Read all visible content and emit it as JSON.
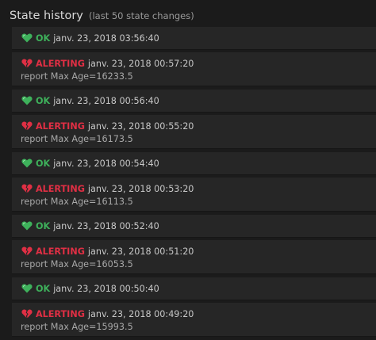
{
  "panel": {
    "title": "State history",
    "subtitle": "(last 50 state changes)"
  },
  "colors": {
    "ok": "#3eb15b",
    "alerting": "#e02f44",
    "background": "#1b1b1b",
    "row": "#262626"
  },
  "entries": [
    {
      "status": "ok",
      "icon": "heart-icon",
      "state": "OK",
      "time": "janv. 23, 2018 03:56:40",
      "detail": ""
    },
    {
      "status": "alert",
      "icon": "broken-heart-icon",
      "state": "ALERTING",
      "time": "janv. 23, 2018 00:57:20",
      "detail": "report Max Age=16233.5"
    },
    {
      "status": "ok",
      "icon": "heart-icon",
      "state": "OK",
      "time": "janv. 23, 2018 00:56:40",
      "detail": ""
    },
    {
      "status": "alert",
      "icon": "broken-heart-icon",
      "state": "ALERTING",
      "time": "janv. 23, 2018 00:55:20",
      "detail": "report Max Age=16173.5"
    },
    {
      "status": "ok",
      "icon": "heart-icon",
      "state": "OK",
      "time": "janv. 23, 2018 00:54:40",
      "detail": ""
    },
    {
      "status": "alert",
      "icon": "broken-heart-icon",
      "state": "ALERTING",
      "time": "janv. 23, 2018 00:53:20",
      "detail": "report Max Age=16113.5"
    },
    {
      "status": "ok",
      "icon": "heart-icon",
      "state": "OK",
      "time": "janv. 23, 2018 00:52:40",
      "detail": ""
    },
    {
      "status": "alert",
      "icon": "broken-heart-icon",
      "state": "ALERTING",
      "time": "janv. 23, 2018 00:51:20",
      "detail": "report Max Age=16053.5"
    },
    {
      "status": "ok",
      "icon": "heart-icon",
      "state": "OK",
      "time": "janv. 23, 2018 00:50:40",
      "detail": ""
    },
    {
      "status": "alert",
      "icon": "broken-heart-icon",
      "state": "ALERTING",
      "time": "janv. 23, 2018 00:49:20",
      "detail": "report Max Age=15993.5"
    }
  ]
}
